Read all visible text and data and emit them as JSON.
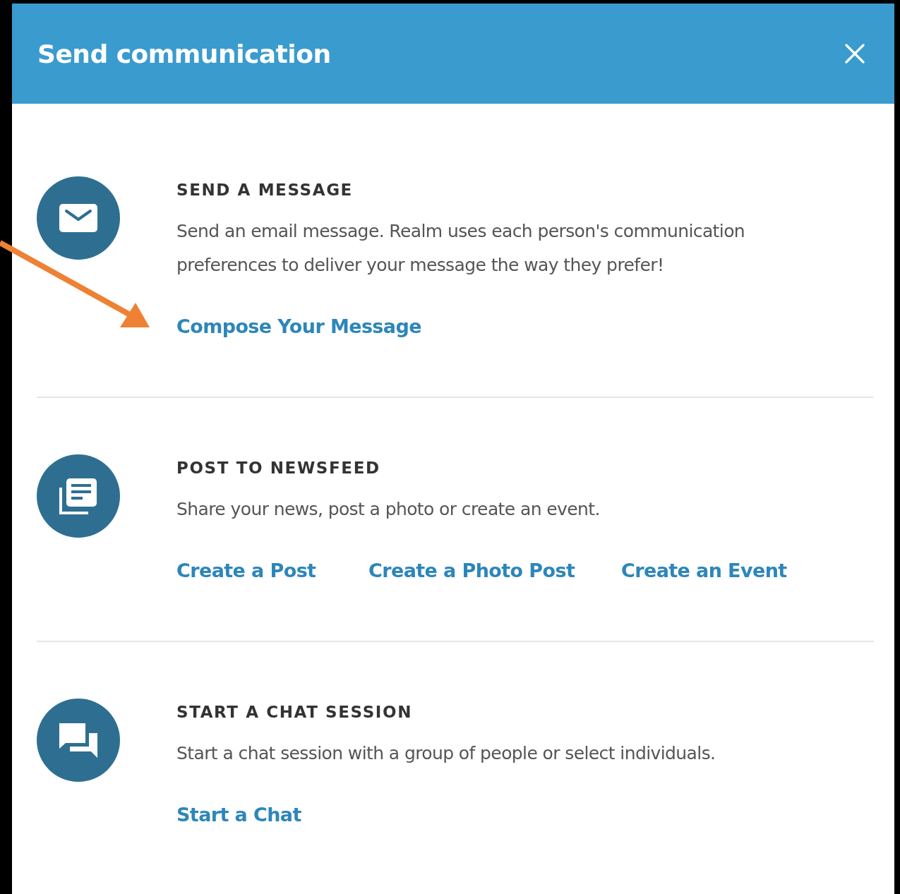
{
  "window": {
    "title": "Send communication"
  },
  "sections": [
    {
      "kind": "message",
      "heading": "SEND A MESSAGE",
      "description": "Send an email message. Realm uses each person's communication preferences to deliver your message the way they prefer!",
      "links": [
        "Compose Your Message"
      ]
    },
    {
      "kind": "newsfeed",
      "heading": "POST TO NEWSFEED",
      "description": "Share your news, post a photo or create an event.",
      "links": [
        "Create a Post",
        "Create a Photo Post",
        "Create an Event"
      ]
    },
    {
      "kind": "chat",
      "heading": "START A CHAT SESSION",
      "description": "Start a chat session with a group of people or select individuals.",
      "links": [
        "Start a Chat"
      ]
    }
  ]
}
